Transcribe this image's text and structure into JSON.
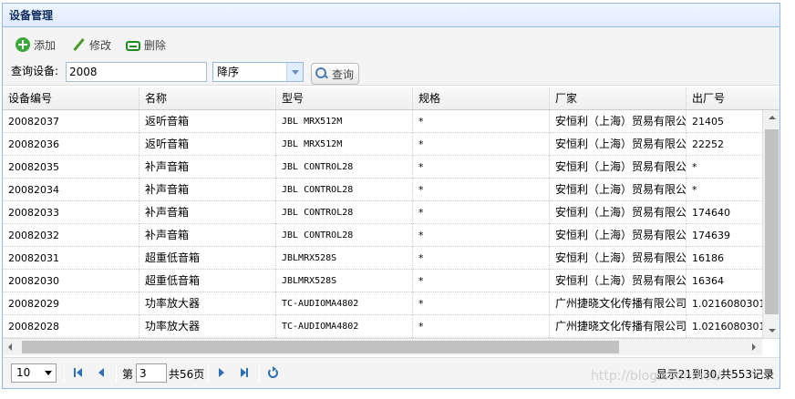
{
  "panel": {
    "title": "设备管理"
  },
  "toolbar": {
    "add_label": "添加",
    "edit_label": "修改",
    "delete_label": "删除",
    "search_label": "查询设备:",
    "search_value": "2008",
    "sort_value": "降序",
    "search_button": "查询"
  },
  "grid": {
    "columns": [
      "设备编号",
      "名称",
      "型号",
      "规格",
      "厂家",
      "出厂号"
    ],
    "rows": [
      [
        "20082037",
        "返听音箱",
        "JBL MRX512M",
        "*",
        "安恒利（上海）贸易有限公司",
        "21405"
      ],
      [
        "20082036",
        "返听音箱",
        "JBL MRX512M",
        "*",
        "安恒利（上海）贸易有限公司",
        "22252"
      ],
      [
        "20082035",
        "补声音箱",
        "JBL CONTROL28",
        "*",
        "安恒利（上海）贸易有限公司",
        "*"
      ],
      [
        "20082034",
        "补声音箱",
        "JBL CONTROL28",
        "*",
        "安恒利（上海）贸易有限公司",
        "*"
      ],
      [
        "20082033",
        "补声音箱",
        "JBL CONTROL28",
        "*",
        "安恒利（上海）贸易有限公司",
        "174640"
      ],
      [
        "20082032",
        "补声音箱",
        "JBL CONTROL28",
        "*",
        "安恒利（上海）贸易有限公司",
        "174639"
      ],
      [
        "20082031",
        "超重低音箱",
        "JBLMRX528S",
        "*",
        "安恒利（上海）贸易有限公司",
        "16186"
      ],
      [
        "20082030",
        "超重低音箱",
        "JBLMRX528S",
        "*",
        "安恒利（上海）贸易有限公司",
        "16364"
      ],
      [
        "20082029",
        "功率放大器",
        "TC-AUDIOMA4802",
        "*",
        "广州捷晓文化传播有限公司",
        "1.0216080301"
      ],
      [
        "20082028",
        "功率放大器",
        "TC-AUDIOMA4802",
        "*",
        "广州捷晓文化传播有限公司",
        "1.0216080301"
      ]
    ]
  },
  "pager": {
    "page_size": "10",
    "page_prefix": "第",
    "current_page": "3",
    "page_total": "共56页",
    "info": "显示21到30,共553记录"
  },
  "watermark": "http://blog.csdn.net/"
}
